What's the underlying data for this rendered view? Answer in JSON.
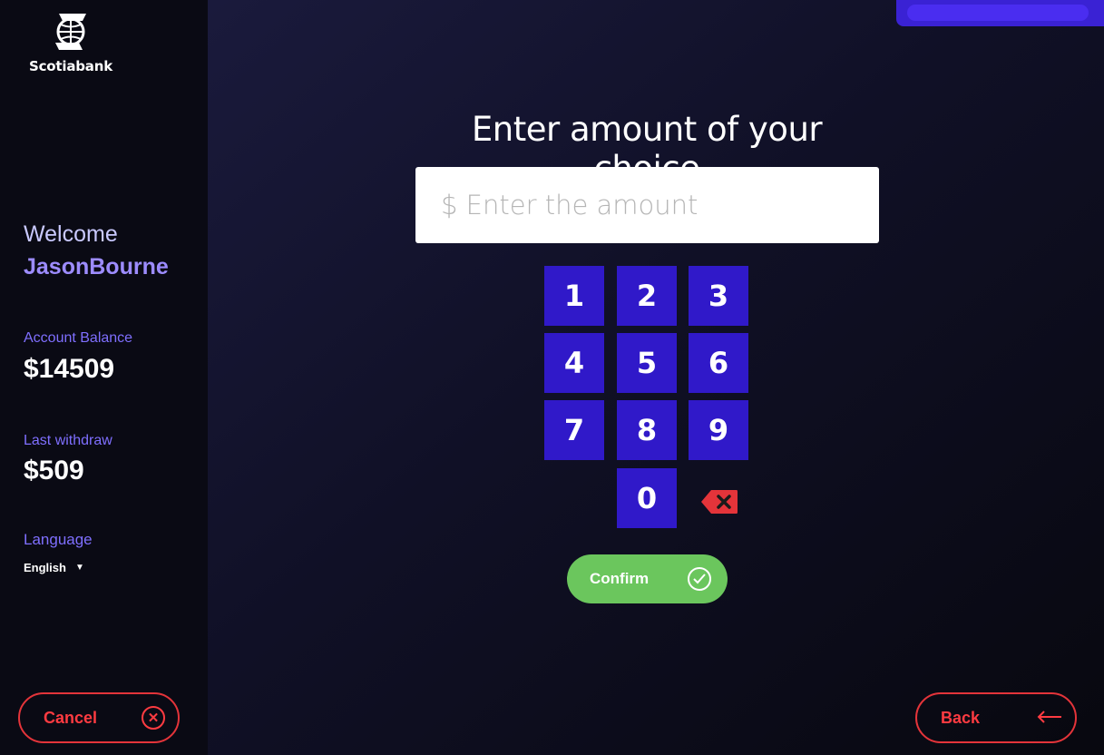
{
  "app": {
    "name": "Scotiabank"
  },
  "sidebar": {
    "welcome_label": "Welcome",
    "username": "JasonBourne",
    "balance_label": "Account Balance",
    "balance_value": "$14509",
    "last_withdraw_label": "Last withdraw",
    "last_withdraw_value": "$509",
    "language_label": "Language",
    "language_value": "English",
    "cancel_label": "Cancel"
  },
  "main": {
    "heading": "Enter amount of your choice",
    "amount_placeholder": "$ Enter the amount",
    "keys": [
      "1",
      "2",
      "3",
      "4",
      "5",
      "6",
      "7",
      "8",
      "9",
      "0"
    ],
    "confirm_label": "Confirm",
    "back_label": "Back"
  },
  "colors": {
    "brand_purple": "#3019c9",
    "accent_red": "#e4343a",
    "confirm_green": "#6bc65d",
    "label_purple": "#7f6fff"
  }
}
